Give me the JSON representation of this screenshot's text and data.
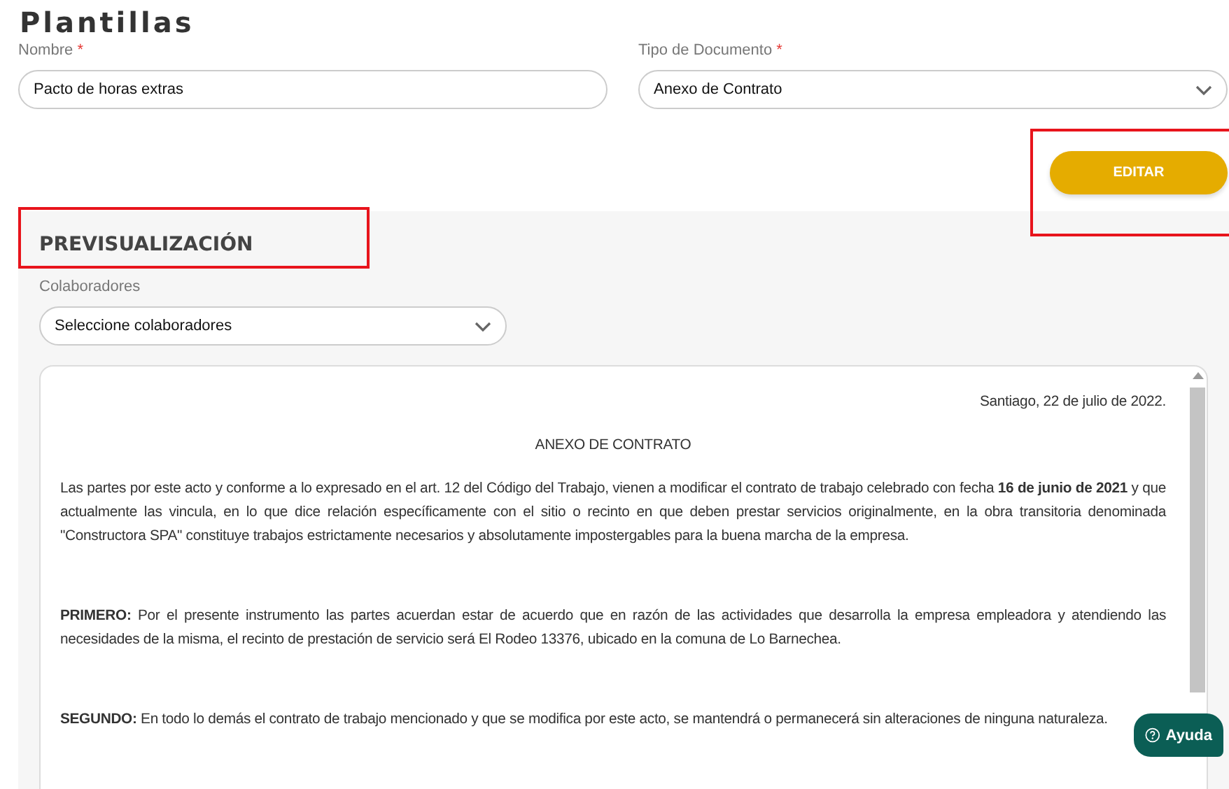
{
  "page": {
    "title": "Plantillas"
  },
  "fields": [
    {
      "kind": "text",
      "label": "Nombre",
      "required_mark": "*",
      "value": "Pacto de horas extras"
    },
    {
      "kind": "select",
      "label": "Tipo de Documento",
      "required_mark": "*",
      "value": "Anexo de Contrato"
    }
  ],
  "edit_button": "EDITAR",
  "preview": {
    "title": "PREVISUALIZACIÓN",
    "collaborators": {
      "label": "Colaboradores",
      "value": "Seleccione colaboradores"
    },
    "document": {
      "date": "Santiago, 22 de julio de 2022.",
      "heading": "ANEXO DE CONTRATO",
      "paragraphs": [
        "Las partes por este acto y conforme a lo expresado en el art. 12 del Código del Trabajo, vienen a modificar el contrato de trabajo celebrado con fecha **16 de junio de 2021** y que actualmente las vincula, en lo que dice relación específicamente con el sitio o recinto en que deben prestar servicios originalmente, en la obra transitoria denominada \"Constructora  SPA\" constituye trabajos estrictamente necesarios y absolutamente impostergables para la buena marcha de la empresa.",
        "**PRIMERO:** Por el presente instrumento las partes acuerdan estar de acuerdo que en razón de las actividades que desarrolla la empresa empleadora y atendiendo las necesidades de la misma, el recinto de prestación de servicio será El Rodeo 13376, ubicado en la comuna de Lo Barnechea.",
        "**SEGUNDO:** En todo lo demás el contrato de trabajo mencionado y que se modifica por este acto, se mantendrá o permanecerá sin alteraciones de ninguna naturaleza."
      ]
    }
  },
  "help_button": {
    "label": "Ayuda"
  }
}
